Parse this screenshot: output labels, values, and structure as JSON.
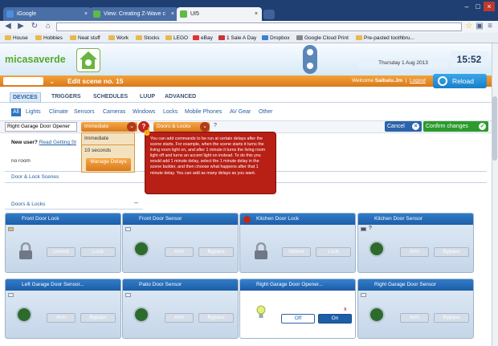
{
  "browser": {
    "tabs": [
      {
        "label": "iGoogle"
      },
      {
        "label": "View: Creating Z-Wave c"
      },
      {
        "label": "UI5"
      }
    ],
    "url": "",
    "bookmarks": [
      "House",
      "Hobbies",
      "Neat stuff",
      "Work",
      "Stocks",
      "LEGO",
      "eBay",
      "1 Sale A Day",
      "Dropbox",
      "Google Cloud Print",
      "Pre-pasted toothbru..."
    ]
  },
  "header": {
    "logo": "micasaverde",
    "date": "Thursday 1 Aug 2013",
    "time": "15:52",
    "scene_title": "Edit scene no. 15",
    "welcome": "Welcome",
    "user": "Saibalu.Jm",
    "logout": "Logout",
    "reload": "Reload"
  },
  "menu": [
    "DEVICES",
    "TRIGGERS",
    "SCHEDULES",
    "LUUP",
    "ADVANCED"
  ],
  "subnav": [
    "All",
    "Lights",
    "Climate",
    "Sensors",
    "Cameras",
    "Windows",
    "Locks",
    "Mobile Phones",
    "AV Gear",
    "Other"
  ],
  "command_bar": {
    "device": "Right Garage Door Opener",
    "delay_selected": "Immediate",
    "room_selected": "Doors & Locks",
    "help": "?",
    "cancel": "Cancel",
    "confirm": "Confirm changes"
  },
  "new_user": {
    "text": "New user?",
    "link": "Read Getting St"
  },
  "delay_menu": {
    "options": [
      "Immediate",
      "10 seconds"
    ],
    "manage": "Manage Delays"
  },
  "tooltip": "You can add commands to be run at certain delays after the scene starts. For example, when the scene starts it turns the living room light on, and after 1 minute it turns the living room light off and turns an accent light on instead. To do this you would add 1 minute delay, select the 1 minute delay in the scene builder, and then choose what happens after that 1 minute delay. You can add as many delays as you want.",
  "sections": {
    "no_room": "no room",
    "door_lock_scenes": "Door & Lock Scenes",
    "doors_locks": "Doors & Locks"
  },
  "cards": [
    {
      "title": "Front Door Lock",
      "btn1": "Unlock",
      "btn2": "Lock"
    },
    {
      "title": "Front Door Sensor",
      "btn1": "Arm",
      "btn2": "Bypass"
    },
    {
      "title": "Kitchen Door Lock",
      "btn1": "Unlock",
      "btn2": "Lock"
    },
    {
      "title": "Kitchen Door Sensor",
      "btn1": "Arm",
      "btn2": "Bypass",
      "status": "?"
    },
    {
      "title": "Left Garage Door Sensor...",
      "btn1": "Arm",
      "btn2": "Bypass"
    },
    {
      "title": "Patio Door Sensor",
      "btn1": "Arm",
      "btn2": "Bypass"
    },
    {
      "title": "Right Garage Door Opener...",
      "btn1": "Off",
      "btn2": "On",
      "close": "x"
    },
    {
      "title": "Right Garage Door Sensor",
      "btn1": "Arm",
      "btn2": "Bypass"
    }
  ],
  "colors": {
    "accent": "#2f74c0",
    "orange": "#e28a24",
    "tooltip": "#b81f15",
    "confirm": "#2b9b2c"
  }
}
